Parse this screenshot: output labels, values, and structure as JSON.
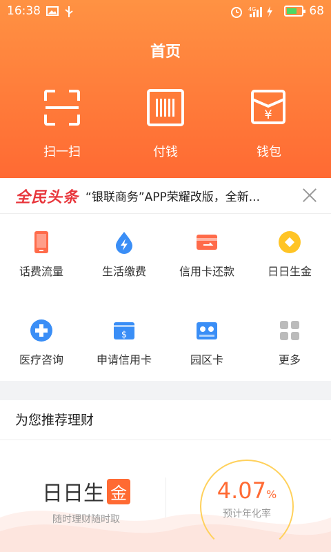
{
  "status_bar": {
    "time": "16:38",
    "network": "4G",
    "battery": "68",
    "battery_level": 0.68
  },
  "header": {
    "title": "首页",
    "actions": [
      {
        "label": "扫一扫",
        "icon": "scan-icon"
      },
      {
        "label": "付钱",
        "icon": "barcode-icon"
      },
      {
        "label": "钱包",
        "icon": "wallet-icon"
      }
    ]
  },
  "news": {
    "logo": "全民头条",
    "headline": "“银联商务”APP荣耀改版，全新..."
  },
  "services": [
    {
      "label": "话费流量",
      "icon": "phone-icon",
      "color": "#ff6b4a"
    },
    {
      "label": "生活缴费",
      "icon": "water-drop-icon",
      "color": "#3a8ef6"
    },
    {
      "label": "信用卡还款",
      "icon": "credit-card-icon",
      "color": "#ff6b4a"
    },
    {
      "label": "日日生金",
      "icon": "gold-coin-icon",
      "color": "#ffc425"
    },
    {
      "label": "医疗咨询",
      "icon": "medical-cross-icon",
      "color": "#3a8ef6"
    },
    {
      "label": "申请信用卡",
      "icon": "card-dollar-icon",
      "color": "#3a8ef6"
    },
    {
      "label": "园区卡",
      "icon": "park-card-icon",
      "color": "#3a8ef6"
    },
    {
      "label": "更多",
      "icon": "more-grid-icon",
      "color": "#bbbbbb"
    }
  ],
  "recommend": {
    "title": "为您推荐理财",
    "product_name": "日日生",
    "product_badge": "金",
    "product_sub": "随时理财随时取",
    "rate": "4.07",
    "rate_unit": "%",
    "rate_label": "预计年化率"
  },
  "colors": {
    "header_top": "#ff9243",
    "header_bottom": "#ff6a33",
    "accent": "#ff6a33"
  }
}
